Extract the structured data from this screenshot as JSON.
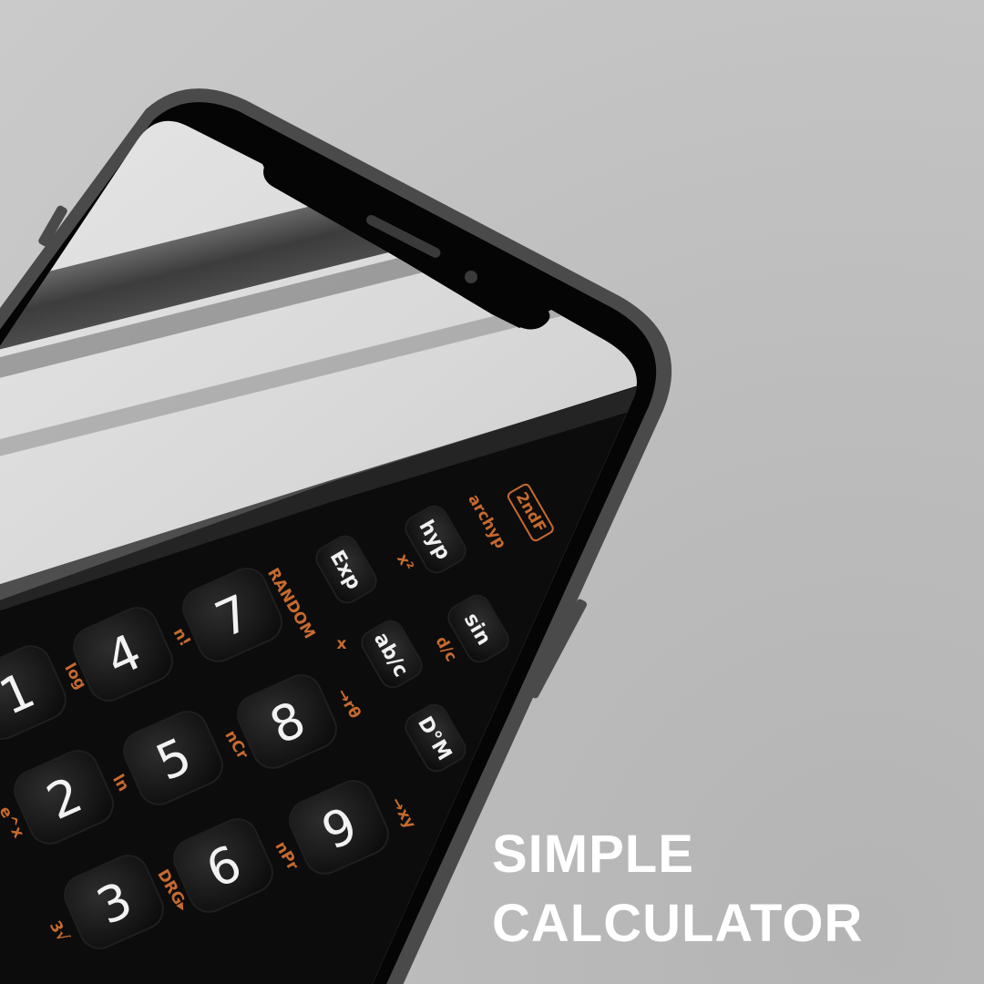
{
  "headline": {
    "line1": "SIMPLE",
    "line2": "CALCULATOR"
  },
  "calculator": {
    "digit_keys": [
      "1",
      "2",
      "3",
      "4",
      "5",
      "6",
      "7",
      "8",
      "9"
    ],
    "function_keys": [
      "Exp",
      "hyp",
      "sin",
      "ab/c",
      "D°M"
    ],
    "secondary_labels": [
      "2ndF",
      "archyp",
      "x²",
      "RANDOM",
      "n!",
      "log",
      "d/c",
      "x",
      "→rθ",
      "nCr",
      "ln",
      "→xy",
      "nPr",
      "DRG▸",
      "e^x",
      "3√"
    ]
  },
  "colors": {
    "background": "#c4c4c4",
    "phone_frame": "#4a4a4a",
    "phone_bezel": "#050505",
    "keypad_label": "#c76a2e",
    "headline": "#ffffff"
  }
}
